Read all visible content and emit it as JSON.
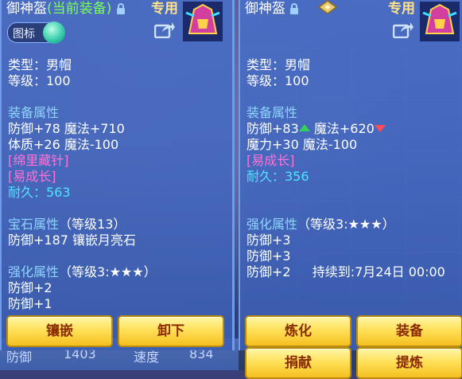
{
  "left": {
    "title": "御神盔",
    "current_tag": "(当前装备)",
    "exclusive": "专用",
    "icon_toggle_label": "图标",
    "type": "类型：男帽",
    "level": "等级：100",
    "equip_attr_header": "装备属性",
    "attr1": "防御+78 魔法+710",
    "attr2": "体质+26 魔法-100",
    "special1": "[绵里藏针]",
    "special2": "[易成长]",
    "durability": "耐久：563",
    "gem_header": "宝石属性",
    "gem_level": "（等级13）",
    "gem_attr": "防御+187 镶嵌月亮石",
    "enhance_header": "强化属性",
    "enhance_level": "（等级3:★★★）",
    "enhance1": "防御+2",
    "enhance2": "防御+1",
    "buttons": [
      "镶嵌",
      "卸下"
    ]
  },
  "right": {
    "title": "御神盔",
    "exclusive": "专用",
    "type": "类型：男帽",
    "level": "等级：100",
    "equip_attr_header": "装备属性",
    "attr1a": "防御+83",
    "attr1b": "魔法+620",
    "attr2": "魔力+30 魔法-100",
    "special1": "[易成长]",
    "durability": "耐久：356",
    "enhance_header": "强化属性",
    "enhance_level": "（等级3:★★★）",
    "enhance1": "防御+3",
    "enhance2": "防御+3",
    "enhance3": "防御+2",
    "duration": "持续到:7月24日 00:00",
    "buttons": [
      "炼化",
      "装备",
      "捐献",
      "提炼"
    ]
  },
  "background": {
    "stat1_label": "防御",
    "stat1_value": "1403",
    "stat2_label": "速度",
    "stat2_value": "834"
  },
  "colors": {
    "accent_green": "#7cff5a",
    "section_blue": "#8fd4ff",
    "special_pink": "#ff73d8",
    "durability_cyan": "#4fe3ff",
    "button_gold": "#ffe05a"
  }
}
